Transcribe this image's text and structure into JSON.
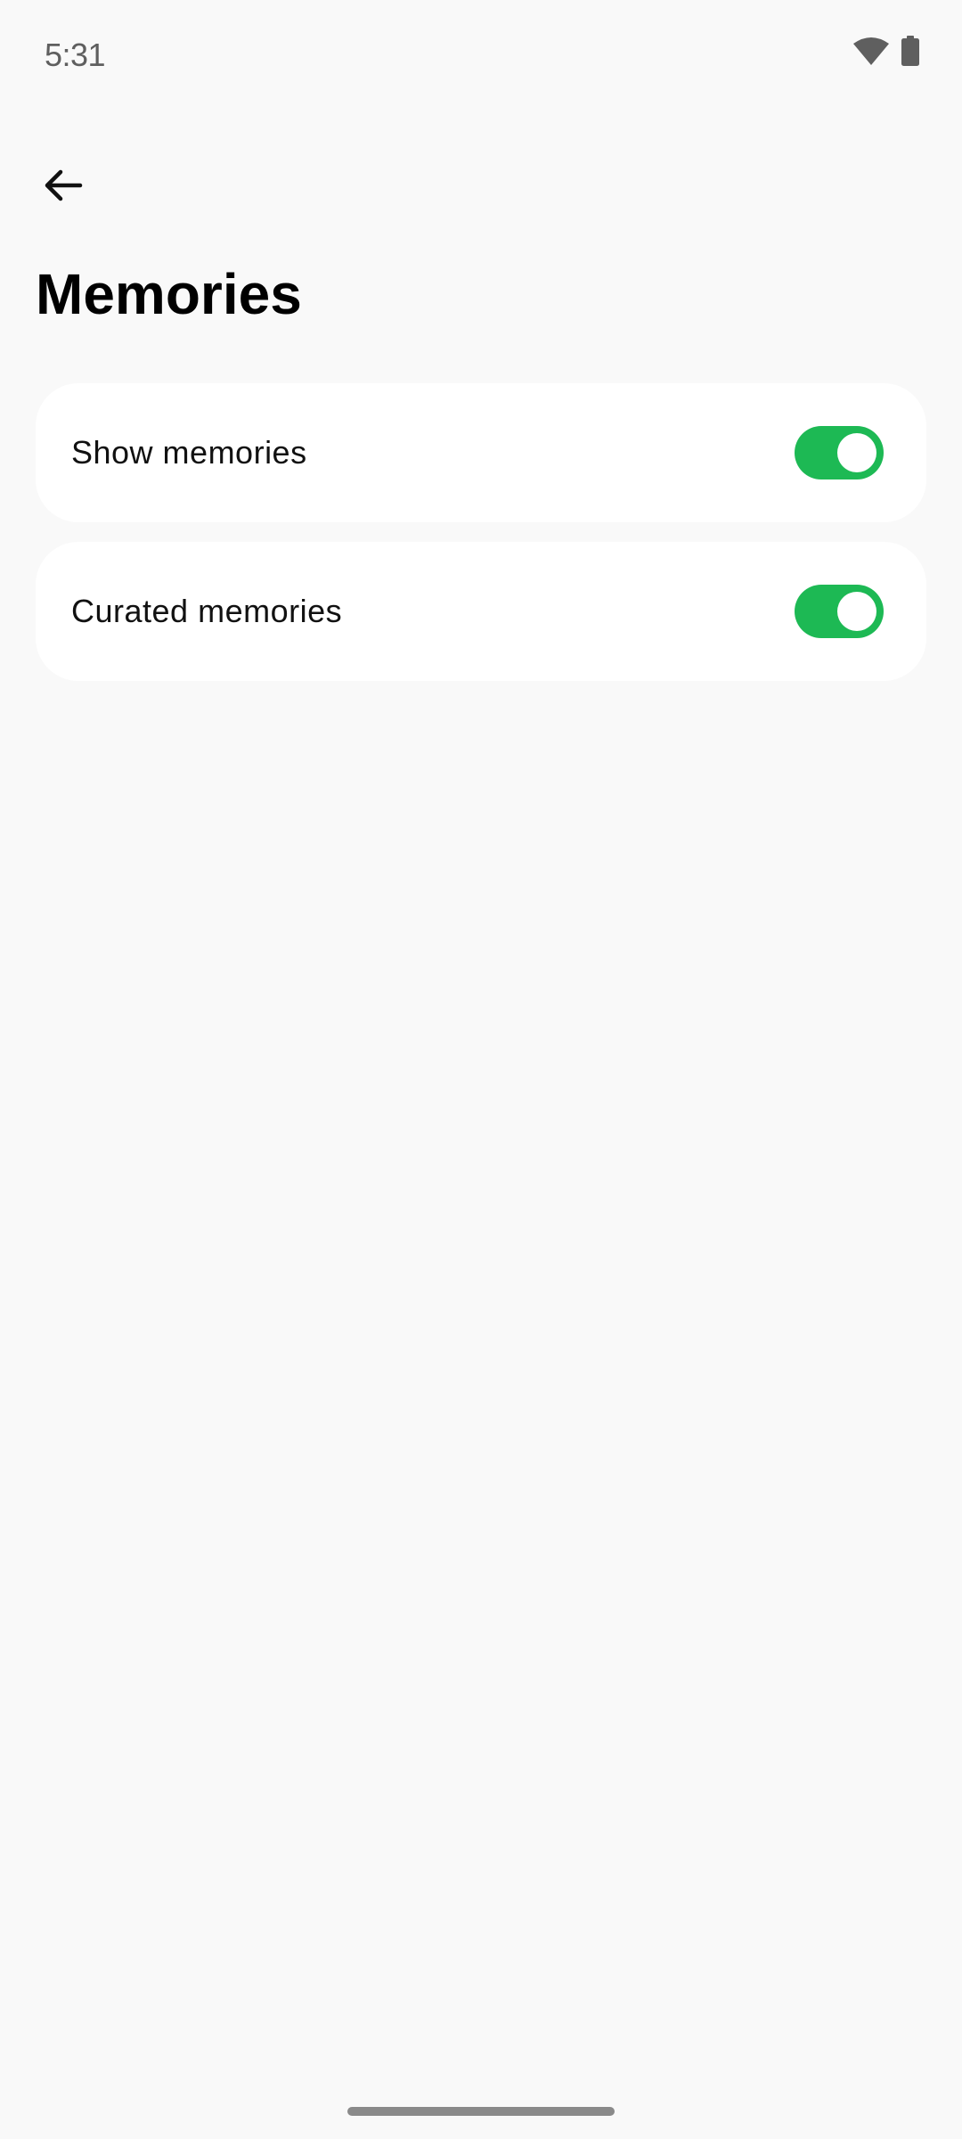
{
  "status_bar": {
    "time": "5:31",
    "icons": [
      "wifi-icon",
      "battery-icon"
    ]
  },
  "app_bar": {
    "back_icon": "arrow-back-icon",
    "title": "Memories"
  },
  "settings": [
    {
      "label": "Show memories",
      "enabled": true
    },
    {
      "label": "Curated memories",
      "enabled": true
    }
  ],
  "colors": {
    "background": "#f9f9f9",
    "card": "#ffffff",
    "toggle_on": "#1db954",
    "status_text": "#5f5f5f"
  }
}
